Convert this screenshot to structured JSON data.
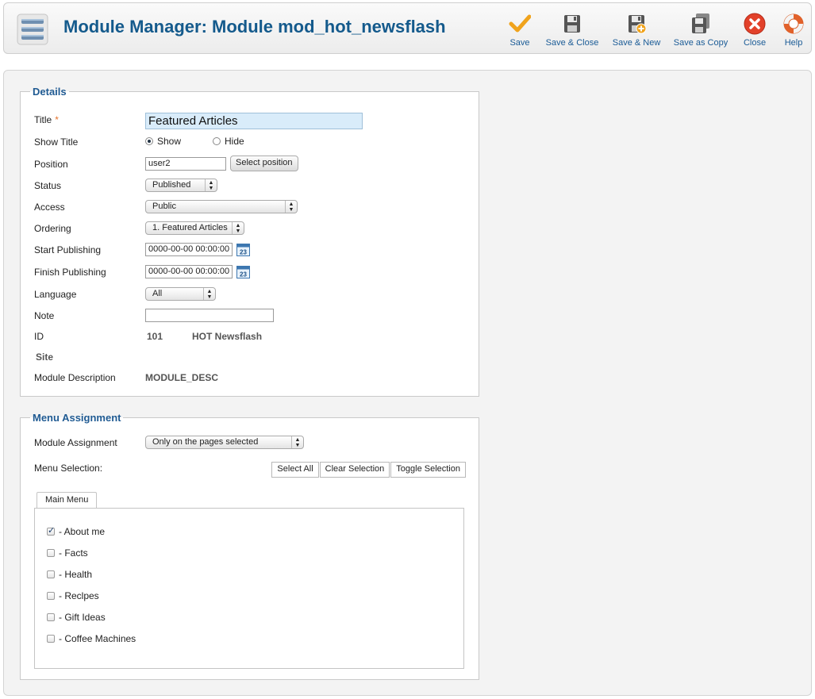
{
  "header": {
    "title": "Module Manager: Module mod_hot_newsflash",
    "icon": "module-stack-icon"
  },
  "toolbar": {
    "buttons": [
      {
        "label": "Save",
        "icon": "checkmark-icon"
      },
      {
        "label": "Save & Close",
        "icon": "floppy-disk-icon"
      },
      {
        "label": "Save & New",
        "icon": "floppy-disk-plus-icon"
      },
      {
        "label": "Save as Copy",
        "icon": "floppy-disks-copy-icon"
      },
      {
        "label": "Close",
        "icon": "close-icon"
      },
      {
        "label": "Help",
        "icon": "lifebuoy-icon"
      }
    ]
  },
  "details": {
    "legend": "Details",
    "title_label": "Title",
    "required_mark": "*",
    "title_value": "Featured Articles",
    "show_title_label": "Show Title",
    "show_option": "Show",
    "hide_option": "Hide",
    "show_title_selected": "Show",
    "position_label": "Position",
    "position_value": "user2",
    "select_position_button": "Select position",
    "status_label": "Status",
    "status_value": "Published",
    "access_label": "Access",
    "access_value": "Public",
    "ordering_label": "Ordering",
    "ordering_value": "1. Featured Articles",
    "start_publishing_label": "Start Publishing",
    "start_publishing_value": "0000-00-00 00:00:00",
    "finish_publishing_label": "Finish Publishing",
    "finish_publishing_value": "0000-00-00 00:00:00",
    "calendar_day": "23",
    "language_label": "Language",
    "language_value": "All",
    "note_label": "Note",
    "note_value": "",
    "id_label": "ID",
    "id_value": "101",
    "module_name": "HOT Newsflash",
    "site_label": "Site",
    "module_description_label": "Module Description",
    "module_description_value": "MODULE_DESC"
  },
  "menu_assignment": {
    "legend": "Menu Assignment",
    "module_assignment_label": "Module Assignment",
    "module_assignment_value": "Only on the pages selected",
    "menu_selection_label": "Menu Selection:",
    "select_all": "Select All",
    "clear_selection": "Clear Selection",
    "toggle_selection": "Toggle Selection",
    "tab_label": "Main Menu",
    "items": [
      {
        "label": "- About me",
        "checked": true
      },
      {
        "label": "- Facts",
        "checked": false
      },
      {
        "label": "- Health",
        "checked": false
      },
      {
        "label": "- Reclpes",
        "checked": false
      },
      {
        "label": "- Gift Ideas",
        "checked": false
      },
      {
        "label": "- Coffee Machines",
        "checked": false
      }
    ]
  }
}
